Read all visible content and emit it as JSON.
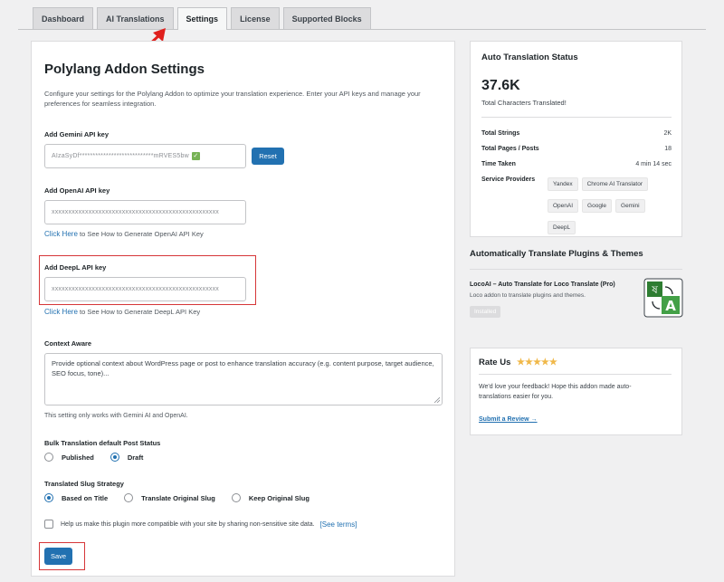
{
  "tabs": [
    "Dashboard",
    "AI Translations",
    "Settings",
    "License",
    "Supported Blocks"
  ],
  "active_tab": "Settings",
  "main": {
    "title": "Polylang Addon Settings",
    "description": "Configure your settings for the Polylang Addon to optimize your translation experience. Enter your API keys and manage your preferences for seamless integration.",
    "gemini": {
      "label": "Add Gemini API key",
      "value": "AIzaSyDf****************************mRVES5bw",
      "reset_label": "Reset"
    },
    "openai": {
      "label": "Add OpenAI API key",
      "value": "xxxxxxxxxxxxxxxxxxxxxxxxxxxxxxxxxxxxxxxxxxxxxxxxxx",
      "link_text": "Click Here",
      "link_suffix": "to See How to Generate OpenAI API Key"
    },
    "deepl": {
      "label": "Add DeepL API key",
      "value": "xxxxxxxxxxxxxxxxxxxxxxxxxxxxxxxxxxxxxxxxxxxxxxxxxx",
      "link_text": "Click Here",
      "link_suffix": "to See How to Generate DeepL API Key"
    },
    "context": {
      "label": "Context Aware",
      "placeholder": "Provide optional context about WordPress page or post to enhance translation accuracy (e.g. content purpose, target audience, SEO focus, tone)...",
      "note": "This setting only works with Gemini AI and OpenAI."
    },
    "bulk_status": {
      "label": "Bulk Translation default Post Status",
      "options": [
        "Published",
        "Draft"
      ],
      "selected": "Draft"
    },
    "slug": {
      "label": "Translated Slug Strategy",
      "options": [
        "Based on Title",
        "Translate Original Slug",
        "Keep Original Slug"
      ],
      "selected": "Based on Title"
    },
    "consent": {
      "text": "Help us make this plugin more compatible with your site by sharing non-sensitive site data.",
      "link": "[See terms]"
    },
    "save_label": "Save"
  },
  "status": {
    "title": "Auto Translation Status",
    "big_number": "37.6K",
    "big_caption": "Total Characters Translated!",
    "rows": [
      {
        "k": "Total Strings",
        "v": "2K"
      },
      {
        "k": "Total Pages / Posts",
        "v": "18"
      },
      {
        "k": "Time Taken",
        "v": "4 min 14 sec"
      }
    ],
    "providers_label": "Service Providers",
    "providers": [
      "Yandex",
      "Chrome AI Translator",
      "OpenAI",
      "Google",
      "Gemini",
      "DeepL"
    ]
  },
  "plugins": {
    "title": "Automatically Translate Plugins & Themes",
    "name": "LocoAI – Auto Translate for Loco Translate (Pro)",
    "desc": "Loco addon to translate plugins and themes.",
    "badge": "Installed"
  },
  "rate": {
    "title": "Rate Us",
    "stars": "★★★★★",
    "text": "We'd love your feedback! Hope this addon made auto-translations easier for you.",
    "link": "Submit a Review →"
  },
  "colors": {
    "accent": "#2271b1",
    "highlight": "#d63638",
    "star": "#f0b849"
  }
}
